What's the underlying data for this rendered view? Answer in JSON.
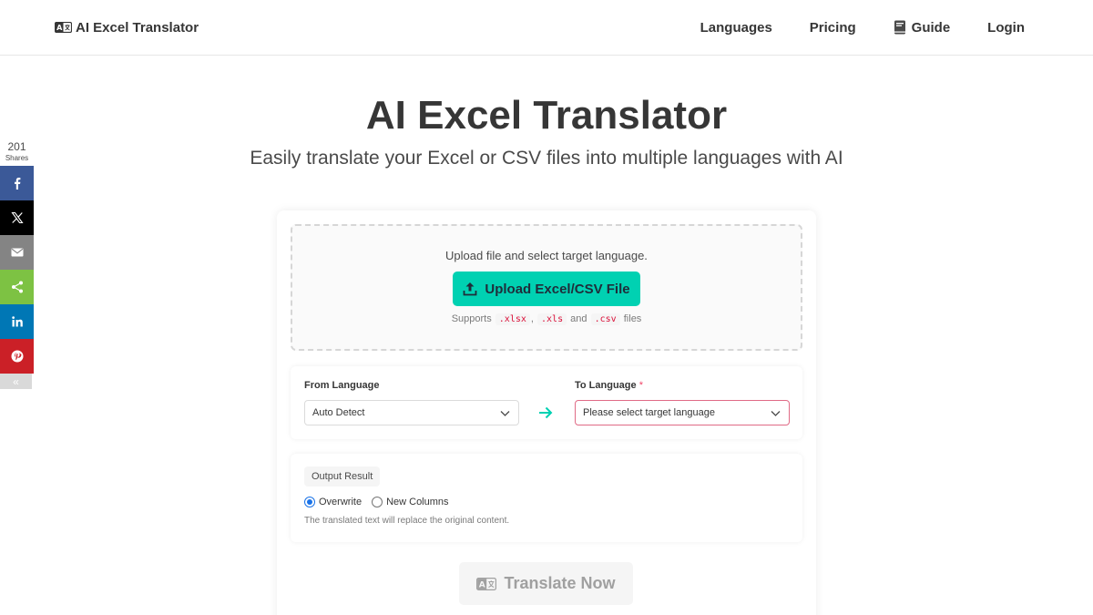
{
  "header": {
    "brand": "AI Excel Translator",
    "nav": {
      "languages": "Languages",
      "pricing": "Pricing",
      "guide": "Guide",
      "login": "Login"
    }
  },
  "share": {
    "count": "201",
    "count_label": "Shares",
    "collapse": "«"
  },
  "hero": {
    "title": "AI Excel Translator",
    "subtitle": "Easily translate your Excel or CSV files into multiple languages with AI"
  },
  "upload": {
    "instruction": "Upload file and select target language.",
    "button": "Upload Excel/CSV File",
    "supports_prefix": "Supports",
    "ext_xlsx": ".xlsx",
    "sep": ",",
    "ext_xls": ".xls",
    "and": "and",
    "ext_csv": ".csv",
    "files": "files"
  },
  "language": {
    "from_label": "From Language",
    "from_value": "Auto Detect",
    "to_label": "To Language",
    "required_mark": "*",
    "to_placeholder": "Please select target language"
  },
  "output": {
    "tag": "Output Result",
    "options": [
      "Overwrite",
      "New Columns"
    ],
    "selected": "Overwrite",
    "help": "The translated text will replace the original content."
  },
  "actions": {
    "translate": "Translate Now"
  },
  "colors": {
    "primary": "#00d1b2",
    "facebook": "#3b5998",
    "x": "#000000",
    "email": "#848484",
    "sharethis": "#7dc243",
    "linkedin": "#0077b5",
    "pinterest": "#cb2027",
    "required": "#f14668",
    "code": "#da1039"
  }
}
